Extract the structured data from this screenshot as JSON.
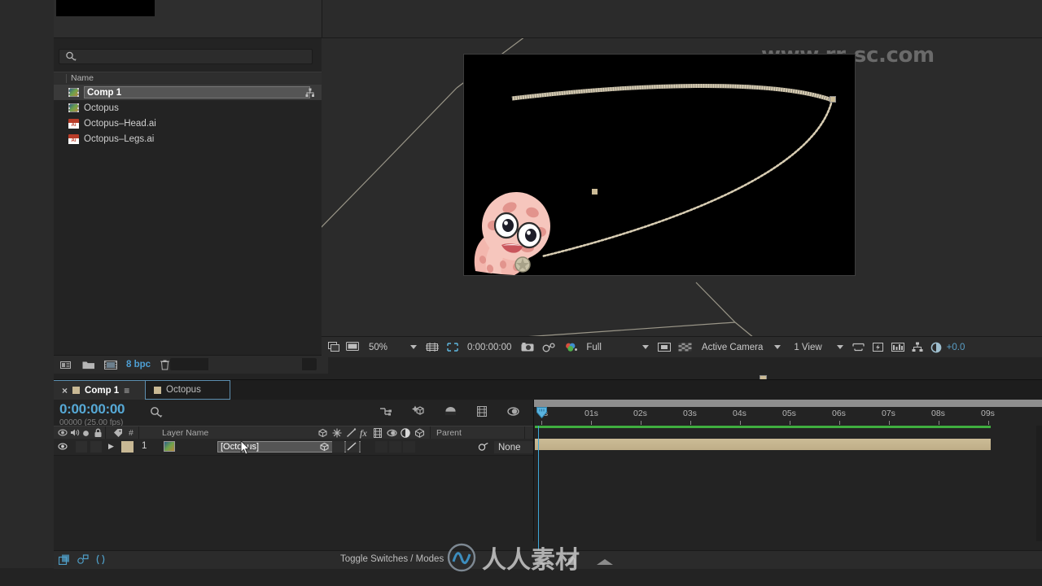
{
  "watermarks": {
    "top": "www.rr-sc.com",
    "bottom_cn": "人人素材"
  },
  "project": {
    "search_placeholder": "",
    "search_value": "",
    "column_header": "Name",
    "items": [
      {
        "label": "Comp 1",
        "icon": "composition-icon",
        "selected": true
      },
      {
        "label": "Octopus",
        "icon": "composition-icon",
        "selected": false
      },
      {
        "label": "Octopus–Head.ai",
        "icon": "illustrator-file-icon",
        "selected": false
      },
      {
        "label": "Octopus–Legs.ai",
        "icon": "illustrator-file-icon",
        "selected": false
      }
    ],
    "footer": {
      "bpc": "8 bpc",
      "icons": [
        "interpret-footage-icon",
        "new-folder-icon",
        "new-composition-icon",
        "delete-icon"
      ]
    }
  },
  "comp_viewer": {
    "toolbar": {
      "always_preview_icon": "always-preview-this-view-icon",
      "main_view_icon": "main-view-icon",
      "magnification": "50%",
      "grid_icon": "choose-grid-and-guide-icon",
      "region_icon": "region-of-interest-icon",
      "timecode": "0:00:00:00",
      "snapshot_icon": "take-snapshot-icon",
      "show_snapshot_icon": "show-snapshot-icon",
      "channels_icon": "show-channel-icon",
      "resolution": "Full",
      "transparency_icon": "toggle-transparency-grid-icon",
      "mask_icon": "toggle-mask-icon",
      "camera_view": "Active Camera",
      "views": "1 View",
      "pixel_aspect_icon": "pixel-aspect-ratio-correction-icon",
      "fast_preview_icon": "fast-previews-icon",
      "timeline_icon": "timeline-icon",
      "flowchart_icon": "comp-flowchart-icon",
      "exposure_icon": "reset-exposure-icon",
      "exposure_value": "+0.0"
    },
    "stage": {
      "background": "#000000",
      "motion_path_color": "#d8cdb3",
      "handle_color": "#cbbb96"
    }
  },
  "timeline": {
    "tabs": [
      {
        "label": "Comp 1",
        "active": true,
        "closable": true,
        "menu_icon": "panel-menu-icon"
      },
      {
        "label": "Octopus",
        "active": false,
        "closable": false
      }
    ],
    "current_time": "0:00:00:00",
    "frame_info": "00000 (25.00 fps)",
    "search_icon": "search-icon",
    "toolbar_icons": [
      "live-update-icon",
      "draft-3d-icon",
      "hide-shy-layers-icon",
      "frame-blending-icon",
      "motion-blur-icon",
      "graph-editor-icon"
    ],
    "columns": {
      "av_features": [
        "video-icon",
        "audio-icon",
        "solo-icon",
        "lock-icon"
      ],
      "label": "",
      "number": "#",
      "layer_name": "Layer Name",
      "switches": [
        "3d-layer-icon",
        "collapse-transformations-icon",
        "quality-icon",
        "effects-icon",
        "frame-blend-icon",
        "motion-blur-icon",
        "adjustment-layer-icon",
        "3d-icon"
      ],
      "parent": "Parent"
    },
    "layers": [
      {
        "index": "1",
        "name": "[Octopus]",
        "parent": "None",
        "label_color": "#c8b894",
        "visible": true,
        "selected": true,
        "name_editing": true
      }
    ],
    "ruler_labels": [
      "0s",
      "01s",
      "02s",
      "03s",
      "04s",
      "05s",
      "06s",
      "07s",
      "08s",
      "09s"
    ],
    "footer": {
      "toggle_label": "Toggle Switches / Modes",
      "left_icons": [
        "render-queue-icon",
        "comp-mini-flowchart-icon",
        "frame-blend-icon"
      ],
      "right_icons": [
        "zoom-out-icon",
        "zoom-slider-icon",
        "zoom-in-icon"
      ]
    }
  }
}
